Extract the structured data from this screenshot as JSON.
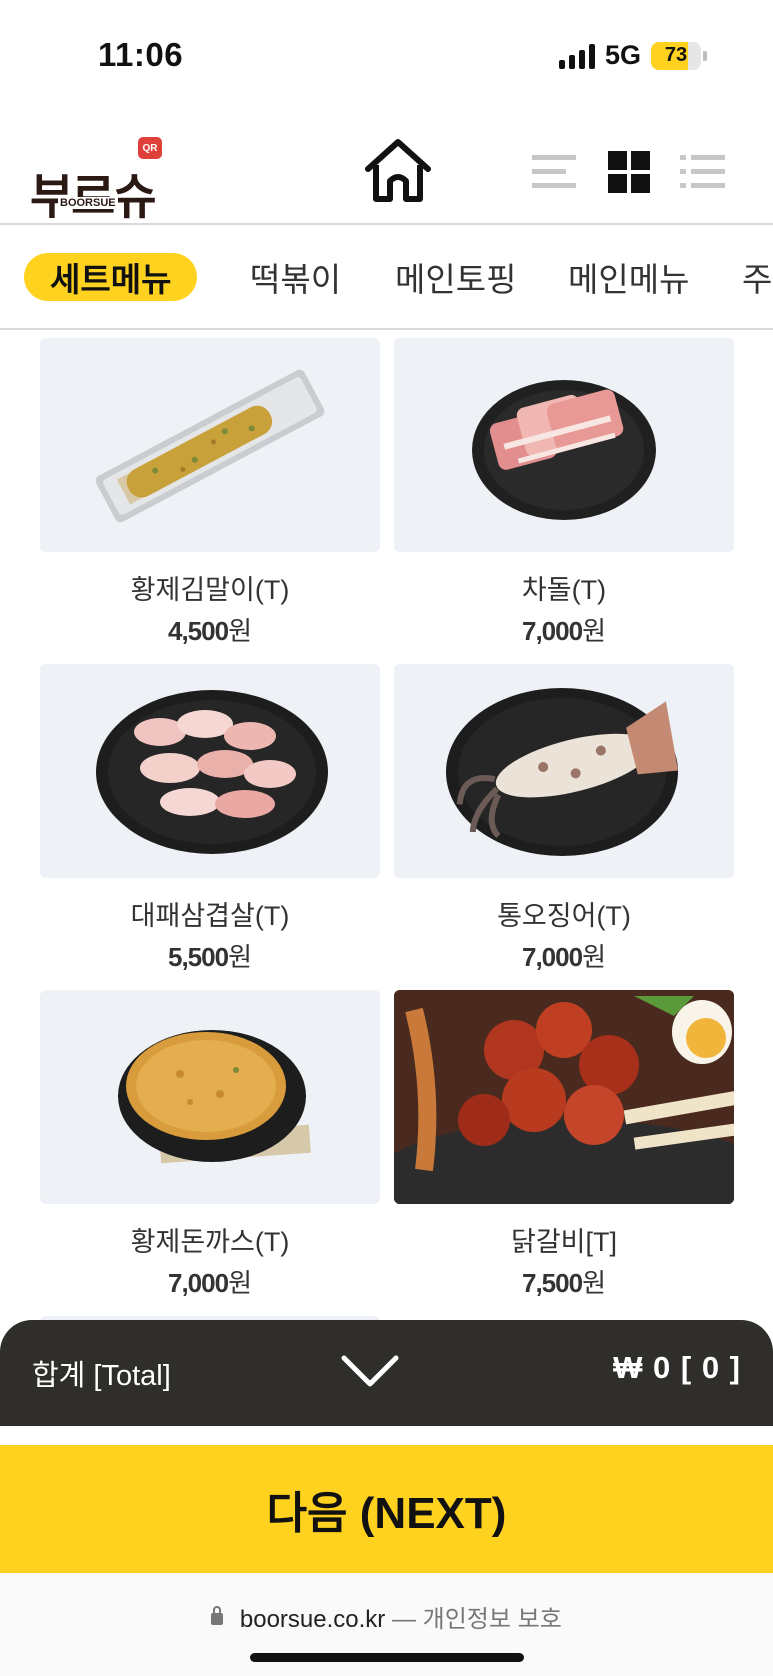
{
  "status_bar": {
    "time": "11:06",
    "network": "5G",
    "battery": "73",
    "battery_level": 0.73
  },
  "header": {
    "logo_text": "부르슈",
    "logo_sub": "BOORSUE",
    "logo_badge": "QR",
    "home_icon": "home-icon",
    "view_icons": [
      "list-view-icon",
      "grid-view-icon",
      "dotted-list-view-icon"
    ]
  },
  "tabs": [
    "세트메뉴",
    "떡볶이",
    "메인토핑",
    "메인메뉴",
    "주"
  ],
  "products": [
    {
      "name": "황제김말이(T)",
      "price": "4,500",
      "unit": "원"
    },
    {
      "name": "차돌(T)",
      "price": "7,000",
      "unit": "원"
    },
    {
      "name": "대패삼겹살(T)",
      "price": "5,500",
      "unit": "원"
    },
    {
      "name": "통오징어(T)",
      "price": "7,000",
      "unit": "원"
    },
    {
      "name": "황제돈까스(T)",
      "price": "7,000",
      "unit": "원"
    },
    {
      "name": "닭갈비[T]",
      "price": "7,500",
      "unit": "원"
    }
  ],
  "total_bar": {
    "label": "합계 [Total]",
    "amount": "₩ 0 [ 0 ]"
  },
  "next_button": "다음 (NEXT)",
  "url_bar": {
    "domain": "boorsue.co.kr",
    "privacy": "— 개인정보 보호"
  },
  "colors": {
    "accent": "#ffd21f",
    "total_bar": "#2f2e2b",
    "logo": "#2b1a14"
  }
}
